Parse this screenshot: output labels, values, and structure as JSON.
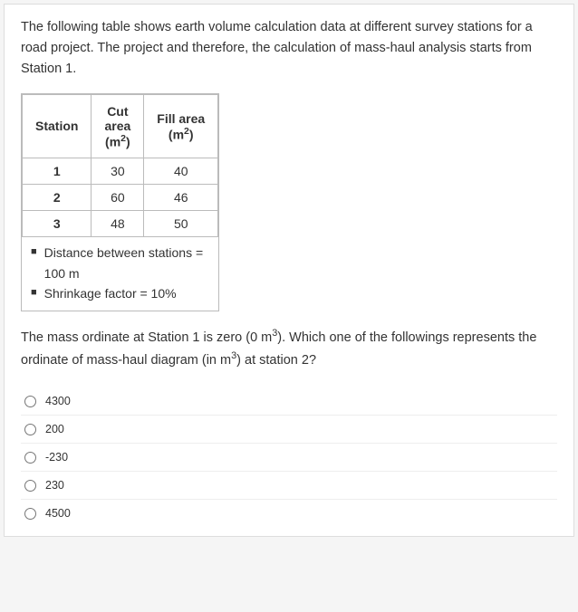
{
  "intro": "The following table shows earth volume calculation data at different survey stations for a road project. The project and therefore, the calculation of mass-haul analysis starts from Station 1.",
  "table": {
    "headers": {
      "station": "Station",
      "cut": "Cut area (m²)",
      "cut_line1": "Cut",
      "cut_line2": "area",
      "cut_line3": "(m²)",
      "fill": "Fill area (m²)",
      "fill_line1": "Fill area",
      "fill_line2": "(m²)"
    },
    "rows": [
      {
        "station": "1",
        "cut": "30",
        "fill": "40"
      },
      {
        "station": "2",
        "cut": "60",
        "fill": "46"
      },
      {
        "station": "3",
        "cut": "48",
        "fill": "50"
      }
    ]
  },
  "notes": {
    "distance": "Distance between stations = 100 m",
    "distance_line1": "Distance between stations =",
    "distance_line2": "100 m",
    "shrinkage": "Shrinkage factor = 10%"
  },
  "question": "The mass ordinate at Station 1 is zero (0 m³). Which one of the followings represents the ordinate of mass-haul diagram (in m³) at station 2?",
  "question_part1": "The mass ordinate at Station 1 is zero (0 m",
  "question_part2": "). Which one of the followings represents the ordinate of mass-haul diagram (in m",
  "question_part3": ") at station 2?",
  "options": [
    {
      "value": "4300",
      "label": "4300"
    },
    {
      "value": "200",
      "label": "200"
    },
    {
      "value": "-230",
      "label": "-230"
    },
    {
      "value": "230",
      "label": "230"
    },
    {
      "value": "4500",
      "label": "4500"
    }
  ]
}
